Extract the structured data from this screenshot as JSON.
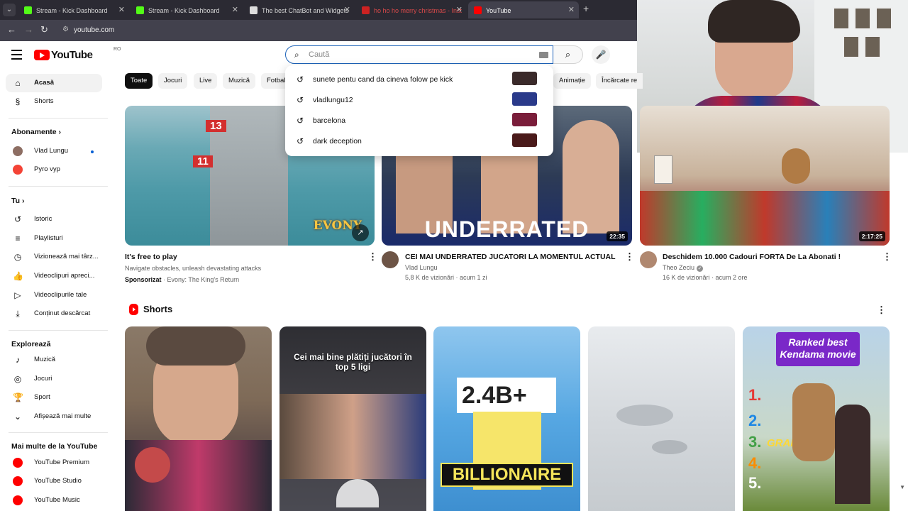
{
  "browser": {
    "tabs": [
      {
        "title": "Stream - Kick Dashboard",
        "favicon_color": "#53fc18",
        "favicon_letter": "K"
      },
      {
        "title": "Stream - Kick Dashboard",
        "favicon_color": "#53fc18",
        "favicon_letter": "K"
      },
      {
        "title": "The best ChatBot and Widgets",
        "favicon_color": "#dddddd",
        "favicon_letter": "◆"
      },
      {
        "title": "ho ho ho merry christmas - Inst",
        "favicon_color": "#cc2222",
        "favicon_letter": ""
      },
      {
        "title": "YouTube",
        "favicon_color": "#ff0000",
        "favicon_letter": "▶"
      }
    ],
    "new_tab_glyph": "+",
    "url": "youtube.com"
  },
  "header": {
    "logo_text": "YouTube",
    "country_code": "RO",
    "search_placeholder": "Caută"
  },
  "search_suggestions": [
    {
      "text": "sunete pentu cand da cineva folow pe kick",
      "thumb_color": "#3a2a2a"
    },
    {
      "text": "vladlungu12",
      "thumb_color": "#2a3a8a"
    },
    {
      "text": "barcelona",
      "thumb_color": "#7a1d3a"
    },
    {
      "text": "dark deception",
      "thumb_color": "#4a1a1a"
    }
  ],
  "sidebar": {
    "main": [
      {
        "label": "Acasă",
        "icon": "home-icon",
        "glyph": "⌂",
        "active": true
      },
      {
        "label": "Shorts",
        "icon": "shorts-icon",
        "glyph": "§",
        "active": false
      }
    ],
    "subscriptions_title": "Abonamente",
    "subscriptions": [
      {
        "label": "Vlad Lungu",
        "color": "#8d6e63",
        "live": true
      },
      {
        "label": "Pyro vyp",
        "color": "#f44336",
        "live": false
      }
    ],
    "you_title": "Tu",
    "you": [
      {
        "label": "Istoric",
        "icon": "history-icon",
        "glyph": "↺"
      },
      {
        "label": "Playlisturi",
        "icon": "playlists-icon",
        "glyph": "≡"
      },
      {
        "label": "Vizionează mai târz...",
        "icon": "watch-later-icon",
        "glyph": "◷"
      },
      {
        "label": "Videoclipuri apreci...",
        "icon": "liked-videos-icon",
        "glyph": "👍"
      },
      {
        "label": "Videoclipurile tale",
        "icon": "your-videos-icon",
        "glyph": "▷"
      },
      {
        "label": "Conținut descărcat",
        "icon": "downloads-icon",
        "glyph": "⤓"
      }
    ],
    "explore_title": "Explorează",
    "explore": [
      {
        "label": "Muzică",
        "icon": "music-icon",
        "glyph": "♪"
      },
      {
        "label": "Jocuri",
        "icon": "gaming-icon",
        "glyph": "◎"
      },
      {
        "label": "Sport",
        "icon": "sports-trophy-icon",
        "glyph": "🏆"
      },
      {
        "label": "Afișează mai multe",
        "icon": "chevron-down-icon",
        "glyph": "⌄"
      }
    ],
    "more_title": "Mai multe de la YouTube",
    "more": [
      {
        "label": "YouTube Premium",
        "color": "#ff0000"
      },
      {
        "label": "YouTube Studio",
        "color": "#ff0000"
      },
      {
        "label": "YouTube Music",
        "color": "#ff0000"
      }
    ]
  },
  "chips": [
    "Toate",
    "Jocuri",
    "Live",
    "Muzică",
    "Fotbal",
    "Animație",
    "Încărcate re"
  ],
  "videos": [
    {
      "title": "It's free to play",
      "line1": "Navigate obstacles, unleash devastating attacks",
      "sponsored_label": "Sponsorizat",
      "sponsor": " · Evony: The King's Return",
      "logo_text": "EVONY",
      "scores": [
        "13",
        "11"
      ]
    },
    {
      "title": "CEI MAI UNDERRATED JUCATORI LA MOMENTUL ACTUAL",
      "channel": "Vlad Lungu",
      "stats": "5,8 K de vizionări · acum 1 zi",
      "duration": "22:35",
      "overlay": "UNDERRATED"
    },
    {
      "title": "Deschidem 10.000 Cadouri FORTA De La Abonati !",
      "channel": "Theo Zeciu",
      "stats": "16 K de vizionări · acum 2 ore",
      "duration": "2:17:25"
    }
  ],
  "shorts": {
    "title": "Shorts",
    "items": [
      {
        "caption": "",
        "bg": "#7a6a5a"
      },
      {
        "caption": "Cei mai bine plătiți jucători în top 5 ligi",
        "bg": "#3d3b3f"
      },
      {
        "caption": "2.4B+",
        "sub": "BILLIONAIRE",
        "bg": "#4fa3e0"
      },
      {
        "caption": "",
        "bg": "#d9dde0"
      },
      {
        "caption": "Ranked best Kendama movie",
        "numbers": [
          "1.",
          "2.",
          "3.",
          "4.",
          "5."
        ],
        "grande": "GRANDE",
        "bg": "#b9d3e8"
      }
    ]
  }
}
